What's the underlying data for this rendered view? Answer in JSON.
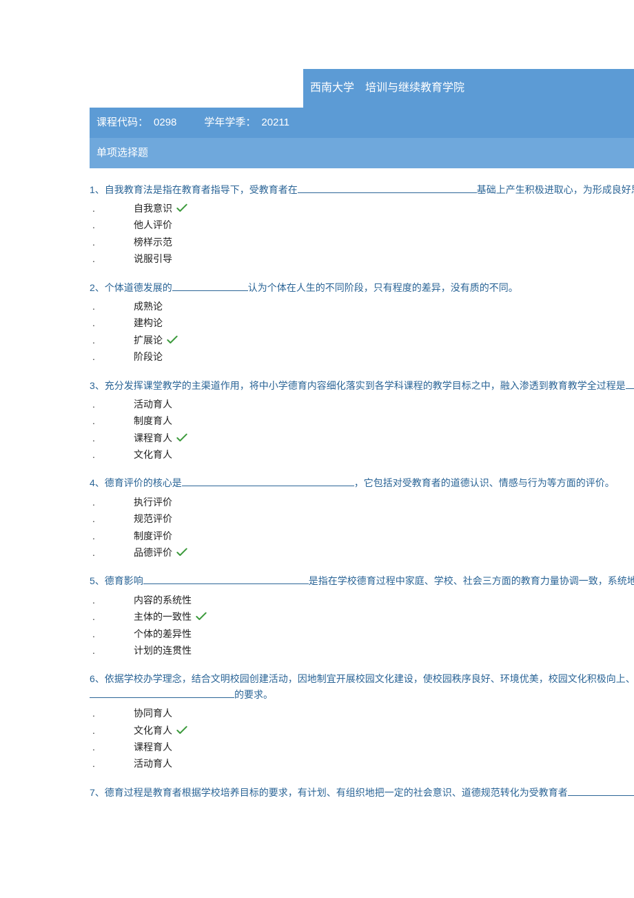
{
  "header": {
    "institution": "西南大学　培训与继续教育学院"
  },
  "info": {
    "course_code_label": "课程代码：",
    "course_code": "0298",
    "semester_label": "学年学季：",
    "semester": "20211"
  },
  "section_title": "单项选择题",
  "bullet": ".",
  "questions": [
    {
      "num": "1、",
      "pre": "自我教育法是指在教育者指导下，受教育者在",
      "post": "基础上产生积极进取心，为形成良好思想品德而",
      "blank_width": 260,
      "options": [
        "自我意识",
        "他人评价",
        "榜样示范",
        "说服引导"
      ],
      "correct": 0
    },
    {
      "num": "2、",
      "pre": "个体道德发展的",
      "post": "认为个体在人生的不同阶段，只有程度的差异，没有质的不同。",
      "blank_width": 110,
      "options": [
        "成熟论",
        "建构论",
        "扩展论",
        "阶段论"
      ],
      "correct": 2
    },
    {
      "num": "3、",
      "pre": "充分发挥课堂教学的主渠道作用，将中小学德育内容细化落实到各学科课程的教学目标之中，融入渗透到教育教学全过程是",
      "post": "",
      "blank_width": 12,
      "options": [
        "活动育人",
        "制度育人",
        "课程育人",
        "文化育人"
      ],
      "correct": 2
    },
    {
      "num": "4、",
      "pre": "德育评价的核心是",
      "post": "，它包括对受教育者的道德认识、情感与行为等方面的评价。",
      "blank_width": 250,
      "options": [
        "执行评价",
        "规范评价",
        "制度评价",
        "品德评价"
      ],
      "correct": 3
    },
    {
      "num": "5、",
      "pre": "德育影响",
      "post": "是指在学校德育过程中家庭、学校、社会三方面的教育力量协调一致，系统地发",
      "blank_width": 240,
      "options": [
        "内容的系统性",
        "主体的一致性",
        "个体的差异性",
        "计划的连贯性"
      ],
      "correct": 1
    },
    {
      "num": "6、",
      "pre": "依据学校办学理念，结合文明校园创建活动，因地制宜开展校园文化建设，使校园秩序良好、环境优美，校园文化积极向上、",
      "post": "",
      "blank_width": 0,
      "suffix_line": "的要求。",
      "suffix_blank_width": 210,
      "options": [
        "协同育人",
        "文化育人",
        "课程育人",
        "活动育人"
      ],
      "correct": 1
    },
    {
      "num": "7、",
      "pre": "德育过程是教育者根据学校培养目标的要求，有计划、有组织地把一定的社会意识、道德规范转化为受教育者",
      "post": "",
      "blank_width": 100,
      "options": [],
      "correct": -1
    }
  ]
}
